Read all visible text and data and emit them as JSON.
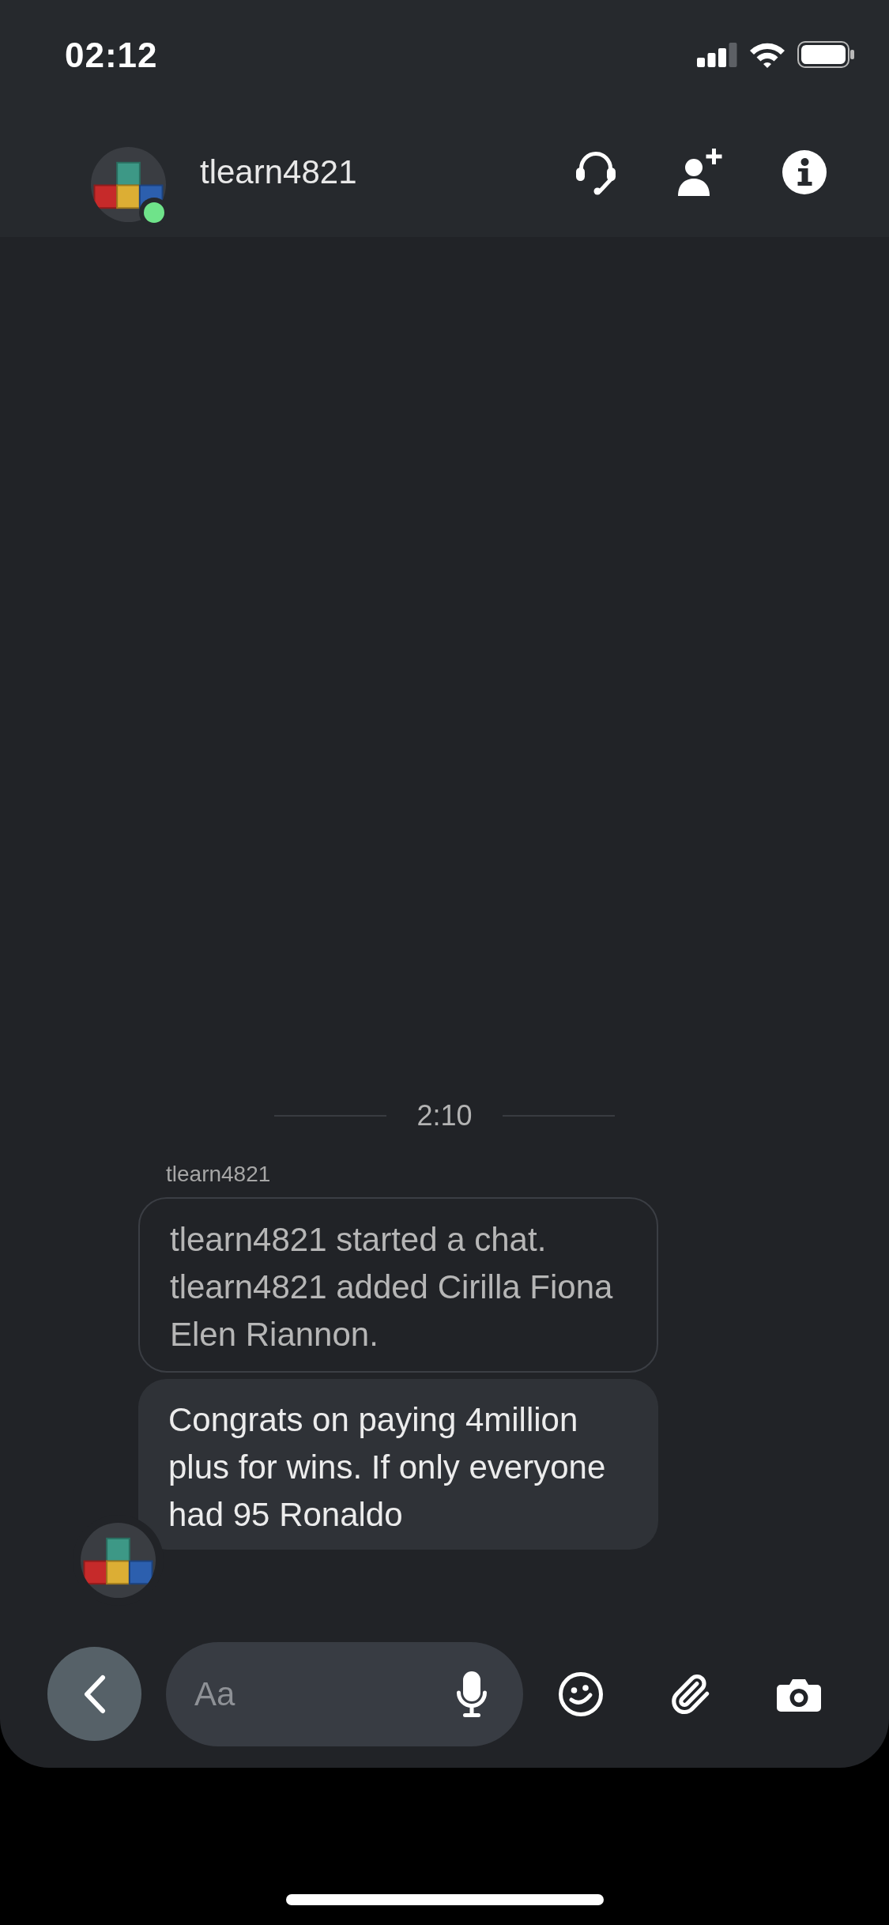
{
  "status_bar": {
    "time": "02:12"
  },
  "header": {
    "avatar": {
      "online": true
    },
    "title": "tlearn4821"
  },
  "chat": {
    "divider_time": "2:10",
    "sender": "tlearn4821",
    "messages": [
      {
        "kind": "system",
        "lines": [
          "tlearn4821 started a chat.",
          "tlearn4821 added Cirilla Fiona Elen Riannon."
        ]
      },
      {
        "kind": "text",
        "text": "Congrats on paying 4million plus for wins. If only everyone had 95 Ronaldo"
      }
    ]
  },
  "composer": {
    "placeholder": "Aa"
  }
}
